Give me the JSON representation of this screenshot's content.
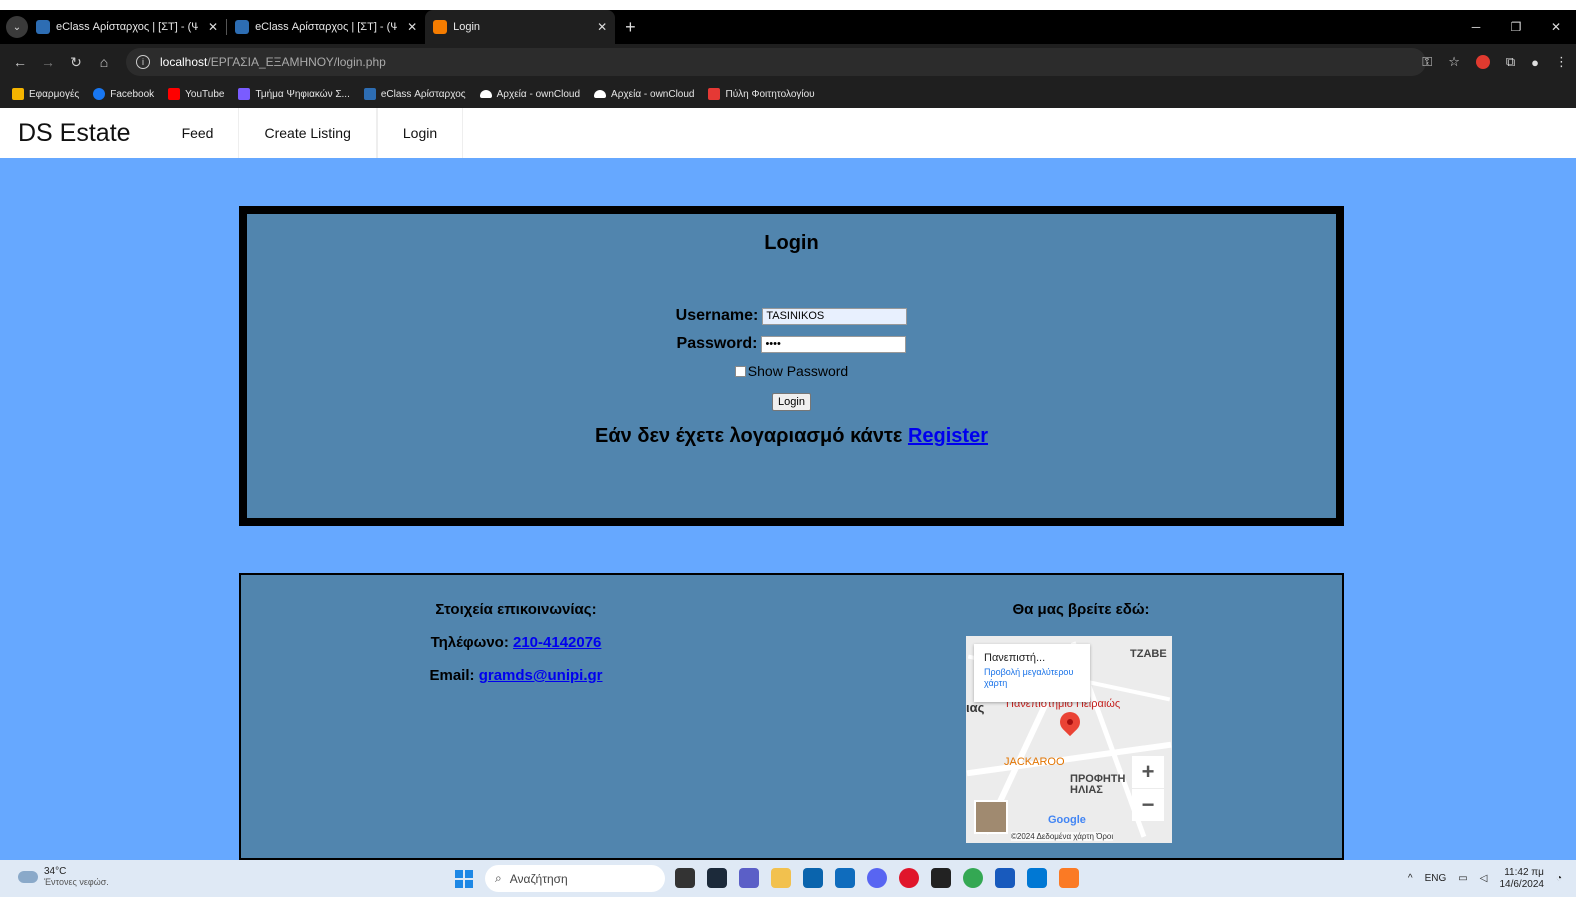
{
  "browser": {
    "tabs": [
      {
        "title": "eClass Αρίσταρχος | [ΣΤ] - (ΨΣ-",
        "close": "✕",
        "active": false,
        "favicon_color": "#2d6db3"
      },
      {
        "title": "eClass Αρίσταρχος | [ΣΤ] - (ΨΣ-",
        "close": "✕",
        "active": false,
        "favicon_color": "#2d6db3"
      },
      {
        "title": "Login",
        "close": "✕",
        "active": true,
        "favicon_color": "#f57c00"
      }
    ],
    "new_tab": "+",
    "window_controls": {
      "minimize": "─",
      "restore": "❐",
      "close": "✕"
    },
    "url_host": "localhost",
    "url_path": "/ΕΡΓΑΣΙΑ_ΕΞΑΜΗΝΟΥ/login.php",
    "bookmarks": [
      {
        "label": "Εφαρμογές",
        "color": "#f4b400"
      },
      {
        "label": "Facebook",
        "color": "#1877f2"
      },
      {
        "label": "YouTube",
        "color": "#ff0000"
      },
      {
        "label": "Τμήμα Ψηφιακών Σ...",
        "color": "#7a5cff"
      },
      {
        "label": "eClass Αρίσταρχος",
        "color": "#2d6db3"
      },
      {
        "label": "Αρχεία - ownCloud",
        "color": "#ffffff"
      },
      {
        "label": "Αρχεία - ownCloud",
        "color": "#ffffff"
      },
      {
        "label": "Πύλη Φοιτητολογίου",
        "color": "#e53935"
      }
    ]
  },
  "site": {
    "brand": "DS Estate",
    "nav": [
      "Feed",
      "Create Listing",
      "Login"
    ]
  },
  "login": {
    "title": "Login",
    "username_label": "Username:",
    "username_value": "TASINIKOS",
    "password_label": "Password:",
    "password_value": "••••",
    "show_password_label": "Show Password",
    "submit_label": "Login",
    "register_text": "Εάν δεν έχετε λογαριασμό κάντε ",
    "register_link": "Register"
  },
  "footer": {
    "contact_title": "Στοιχεία επικοινωνίας:",
    "phone_label": "Τηλέφωνο: ",
    "phone_value": "210-4142076",
    "email_label": "Email: ",
    "email_value": "gramds@unipi.gr",
    "map_title": "Θα μας βρείτε εδώ:",
    "map": {
      "card_title": "Πανεπιστή...",
      "card_link": "Προβολή μεγαλύτερου χάρτη",
      "place_label": "Πανεπιστήμιο Πειραιώς",
      "area_1": "ΤΖΑΒΕ",
      "area_2": "ΠΡΟΦΗΤΗ ΗΛΙΑΣ",
      "poi": "JACKAROO",
      "partial_label": "ιας",
      "copyright": "©2024 Δεδομένα χάρτη  Όροι",
      "google": "Google",
      "zoom_in": "+",
      "zoom_out": "−"
    }
  },
  "taskbar": {
    "weather_temp": "34°C",
    "weather_desc": "Έντονες νεφώσ.",
    "search_placeholder": "Αναζήτηση",
    "lang": "ENG",
    "time": "11:42 πμ",
    "date": "14/6/2024",
    "tray_chevron": "^"
  }
}
